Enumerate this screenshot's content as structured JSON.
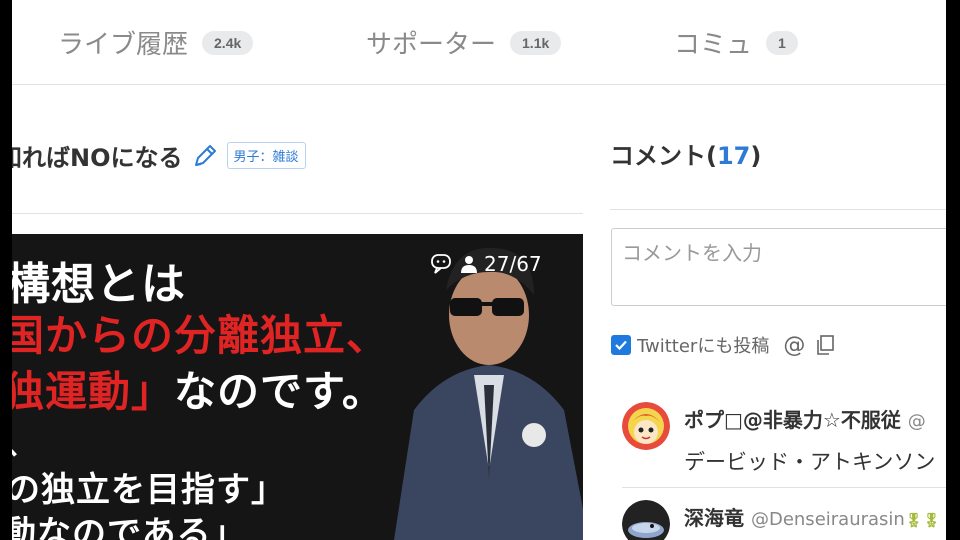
{
  "tabs": [
    {
      "label": "ライブ履歴",
      "count": "2.4k"
    },
    {
      "label": "サポーター",
      "count": "1.1k"
    },
    {
      "label": "コミュ",
      "count": "1"
    }
  ],
  "broadcast": {
    "title": "知ればNOになる",
    "category": "男子：雑談"
  },
  "video": {
    "captions": {
      "line1": "構想とは",
      "line2": "国からの分離独立、",
      "line3_red": "独運動」",
      "line3_white": "なのです。",
      "line4": "、",
      "line5": "の独立を目指す」",
      "line6": "動なのである」"
    },
    "viewer_count": "27/67"
  },
  "comments": {
    "header_label": "コメント",
    "header_count_open": "(",
    "header_count": "17",
    "header_count_close": ")",
    "input_placeholder": "コメントを入力",
    "twitter_label": "Twitterにも投稿",
    "at_symbol": "@",
    "items": [
      {
        "name": "ポプ□@非暴力☆不服従",
        "handle": "@",
        "text": "デービッド・アトキンソン"
      },
      {
        "name": "深海竜",
        "handle": "@Denseiraurasin",
        "badge": "🎖🎖",
        "text": ""
      }
    ]
  },
  "colors": {
    "accent": "#2d7bd6",
    "checkbox": "#1f7ae0",
    "caption_red": "#e02424",
    "divider": "#e2e2e2"
  },
  "icons": [
    "pencil-icon",
    "comment-icon",
    "person-icon",
    "check-icon",
    "at-icon",
    "copy-icon"
  ]
}
